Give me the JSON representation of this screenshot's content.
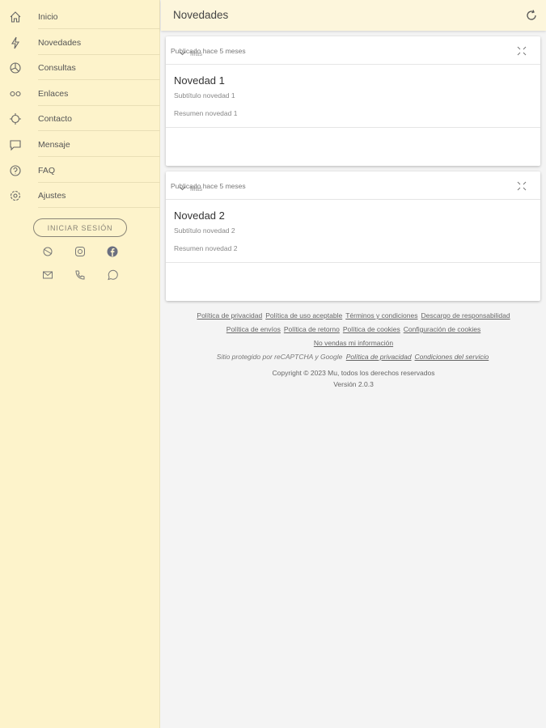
{
  "sidebar": {
    "items": [
      {
        "label": "Inicio",
        "icon": "home-icon"
      },
      {
        "label": "Novedades",
        "icon": "lightning-icon"
      },
      {
        "label": "Consultas",
        "icon": "pie-chart-icon"
      },
      {
        "label": "Enlaces",
        "icon": "link-icon"
      },
      {
        "label": "Contacto",
        "icon": "contact-icon"
      },
      {
        "label": "Mensaje",
        "icon": "message-icon"
      },
      {
        "label": "FAQ",
        "icon": "help-icon"
      },
      {
        "label": "Ajustes",
        "icon": "gear-icon"
      }
    ],
    "login_label": "INICIAR SESIÓN"
  },
  "header": {
    "title": "Novedades"
  },
  "cards": [
    {
      "published": "Publicado hace 5 meses",
      "title": "Novedad 1",
      "subtitle": "Subtítulo novedad 1",
      "summary": "Resumen novedad 1",
      "more": "Más"
    },
    {
      "published": "Publicado hace 5 meses",
      "title": "Novedad 2",
      "subtitle": "Subtítulo novedad 2",
      "summary": "Resumen novedad 2",
      "more": "Más"
    }
  ],
  "footer": {
    "links1": [
      "Política de privacidad",
      "Política de uso aceptable",
      "Términos y condiciones",
      "Descargo de responsabilidad"
    ],
    "links2": [
      "Política de envíos",
      "Política de retorno",
      "Política de cookies",
      "Configuración de cookies"
    ],
    "links3": [
      "No vendas mi información"
    ],
    "recaptcha": "Sitio protegido por reCAPTCHA y Google",
    "recaptcha_links": [
      "Política de privacidad",
      "Condiciones del servicio"
    ],
    "copyright": "Copyright © 2023 Mu, todos los derechos reservados",
    "version": "Versión 2.0.3"
  }
}
